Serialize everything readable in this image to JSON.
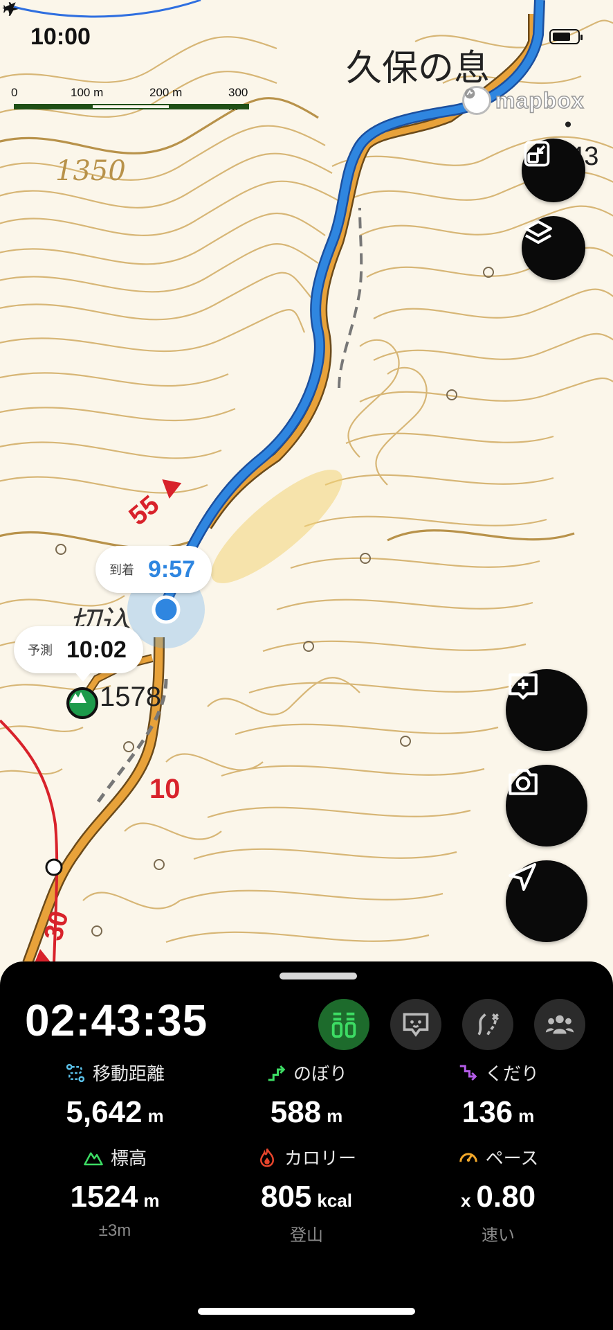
{
  "status_bar": {
    "time": "10:00",
    "location_icon": "location-arrow-icon",
    "airplane_icon": "airplane-icon",
    "battery_icon": "battery-icon"
  },
  "map": {
    "scale_labels": [
      "0",
      "100 m",
      "200 m",
      "300 m"
    ],
    "place_name": "久保の息",
    "contour_label": "1350",
    "spot_height": "・143",
    "summit_label": "1578",
    "summit_partial_label": "切込",
    "route_marks": [
      "55",
      "10",
      "30"
    ],
    "attribution": "mapbox",
    "colors": {
      "route": "#2f86e0",
      "trail": "#e8a23a",
      "contour": "#c9a25a",
      "redline": "#d8222b"
    }
  },
  "bubbles": {
    "arrival": {
      "label": "到着",
      "time": "9:57"
    },
    "forecast": {
      "label": "予測",
      "time": "10:02"
    }
  },
  "buttons": {
    "fit": "fit-screen-icon",
    "layers": "layers-icon",
    "add_memo": "add-memo-icon",
    "camera": "camera-icon",
    "locate": "locate-arrow-icon"
  },
  "panel": {
    "elapsed": "02:43:35",
    "modes": [
      "hiking-mode-icon",
      "dog-mode-icon",
      "route-mode-icon",
      "group-mode-icon"
    ],
    "stats": [
      {
        "label": "移動距離",
        "icon": "distance-icon",
        "value": "5,642",
        "unit": "m",
        "prefix": "",
        "sub": ""
      },
      {
        "label": "のぼり",
        "icon": "ascent-icon",
        "value": "588",
        "unit": "m",
        "prefix": "",
        "sub": ""
      },
      {
        "label": "くだり",
        "icon": "descent-icon",
        "value": "136",
        "unit": "m",
        "prefix": "",
        "sub": ""
      },
      {
        "label": "標高",
        "icon": "elevation-icon",
        "value": "1524",
        "unit": "m",
        "prefix": "",
        "sub": "±3m"
      },
      {
        "label": "カロリー",
        "icon": "calorie-icon",
        "value": "805",
        "unit": "kcal",
        "prefix": "",
        "sub": "登山"
      },
      {
        "label": "ペース",
        "icon": "pace-icon",
        "value": "0.80",
        "unit": "",
        "prefix": "x",
        "sub": "速い"
      }
    ]
  }
}
